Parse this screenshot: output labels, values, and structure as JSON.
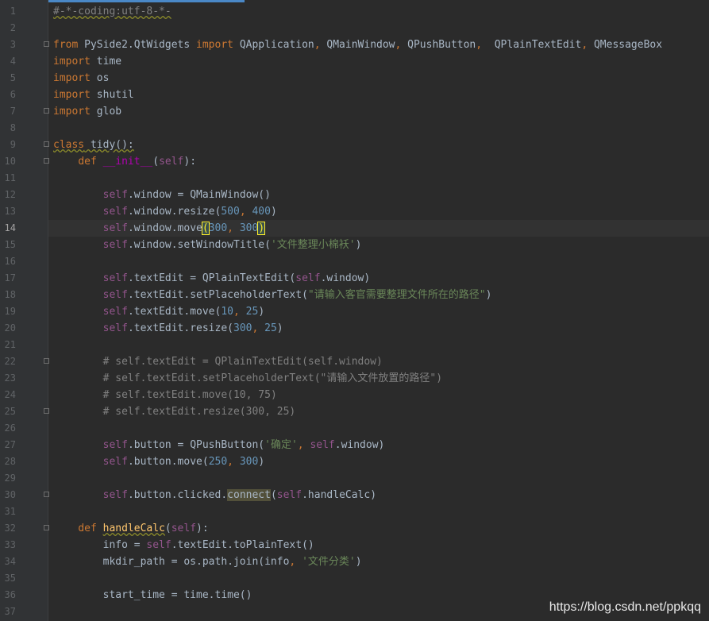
{
  "editor": {
    "watermark": "https://blog.csdn.net/ppkqq",
    "lines": [
      {
        "n": "1",
        "tokens": [
          [
            "#-*-coding:utf-8-*-",
            "cmt wavy"
          ]
        ]
      },
      {
        "n": "2",
        "tokens": []
      },
      {
        "n": "3",
        "fold": true,
        "tokens": [
          [
            "from",
            "kw"
          ],
          [
            " PySide2.QtWidgets ",
            ""
          ],
          [
            "import",
            "kw"
          ],
          [
            " QApplication",
            ""
          ],
          [
            ",",
            "kw"
          ],
          [
            " QMainWindow",
            ""
          ],
          [
            ",",
            "kw"
          ],
          [
            " QPushButton",
            ""
          ],
          [
            ",",
            "kw"
          ],
          [
            "  QPlainTextEdit",
            ""
          ],
          [
            ",",
            "kw"
          ],
          [
            " QMessageBox",
            ""
          ]
        ]
      },
      {
        "n": "4",
        "tokens": [
          [
            "import",
            "kw"
          ],
          [
            " time",
            ""
          ]
        ]
      },
      {
        "n": "5",
        "tokens": [
          [
            "import",
            "kw"
          ],
          [
            " os",
            ""
          ]
        ]
      },
      {
        "n": "6",
        "tokens": [
          [
            "import",
            "kw"
          ],
          [
            " shutil",
            ""
          ]
        ]
      },
      {
        "n": "7",
        "fold": true,
        "tokens": [
          [
            "import",
            "kw"
          ],
          [
            " glob",
            ""
          ]
        ]
      },
      {
        "n": "8",
        "tokens": []
      },
      {
        "n": "9",
        "fold": true,
        "tokens": [
          [
            "class",
            "kw wavy"
          ],
          [
            " tidy():",
            "wavy"
          ]
        ]
      },
      {
        "n": "10",
        "fold": true,
        "tokens": [
          [
            "    ",
            ""
          ],
          [
            "def",
            "kw"
          ],
          [
            " ",
            ""
          ],
          [
            "__init__",
            "magic"
          ],
          [
            "(",
            ""
          ],
          [
            "self",
            "self"
          ],
          [
            "):",
            ""
          ]
        ]
      },
      {
        "n": "11",
        "tokens": []
      },
      {
        "n": "12",
        "tokens": [
          [
            "        ",
            ""
          ],
          [
            "self",
            "self"
          ],
          [
            ".window = QMainWindow()",
            ""
          ]
        ]
      },
      {
        "n": "13",
        "tokens": [
          [
            "        ",
            ""
          ],
          [
            "self",
            "self"
          ],
          [
            ".window.resize(",
            ""
          ],
          [
            "500",
            "num"
          ],
          [
            ", ",
            "kw"
          ],
          [
            "400",
            "num"
          ],
          [
            ")",
            ""
          ]
        ]
      },
      {
        "n": "14",
        "current": true,
        "tokens": [
          [
            "        ",
            ""
          ],
          [
            "self",
            "self"
          ],
          [
            ".window.move",
            ""
          ],
          [
            "(",
            "brace-hl"
          ],
          [
            "300",
            "num"
          ],
          [
            ", ",
            "kw"
          ],
          [
            "300",
            "num"
          ],
          [
            ")",
            "brace-hl"
          ],
          [
            "|",
            "caret"
          ]
        ]
      },
      {
        "n": "15",
        "tokens": [
          [
            "        ",
            ""
          ],
          [
            "self",
            "self"
          ],
          [
            ".window.setWindowTitle(",
            ""
          ],
          [
            "'文件整理小棉袄'",
            "str"
          ],
          [
            ")",
            ""
          ]
        ]
      },
      {
        "n": "16",
        "tokens": []
      },
      {
        "n": "17",
        "tokens": [
          [
            "        ",
            ""
          ],
          [
            "self",
            "self"
          ],
          [
            ".textEdit = QPlainTextEdit(",
            ""
          ],
          [
            "self",
            "self"
          ],
          [
            ".window)",
            ""
          ]
        ]
      },
      {
        "n": "18",
        "tokens": [
          [
            "        ",
            ""
          ],
          [
            "self",
            "self"
          ],
          [
            ".textEdit.setPlaceholderText(",
            ""
          ],
          [
            "\"请输入客官需要整理文件所在的路径\"",
            "str"
          ],
          [
            ")",
            ""
          ]
        ]
      },
      {
        "n": "19",
        "tokens": [
          [
            "        ",
            ""
          ],
          [
            "self",
            "self"
          ],
          [
            ".textEdit.move(",
            ""
          ],
          [
            "10",
            "num"
          ],
          [
            ", ",
            "kw"
          ],
          [
            "25",
            "num"
          ],
          [
            ")",
            ""
          ]
        ]
      },
      {
        "n": "20",
        "tokens": [
          [
            "        ",
            ""
          ],
          [
            "self",
            "self"
          ],
          [
            ".textEdit.resize(",
            ""
          ],
          [
            "300",
            "num"
          ],
          [
            ", ",
            "kw"
          ],
          [
            "25",
            "num"
          ],
          [
            ")",
            ""
          ]
        ]
      },
      {
        "n": "21",
        "tokens": []
      },
      {
        "n": "22",
        "fold": true,
        "tokens": [
          [
            "        ",
            ""
          ],
          [
            "# self.textEdit = QPlainTextEdit(self.window)",
            "cmt"
          ]
        ]
      },
      {
        "n": "23",
        "tokens": [
          [
            "        ",
            ""
          ],
          [
            "# self.textEdit.setPlaceholderText(\"请输入文件放置的路径\")",
            "cmt"
          ]
        ]
      },
      {
        "n": "24",
        "tokens": [
          [
            "        ",
            ""
          ],
          [
            "# self.textEdit.move(10, 75)",
            "cmt"
          ]
        ]
      },
      {
        "n": "25",
        "fold": true,
        "tokens": [
          [
            "        ",
            ""
          ],
          [
            "# self.textEdit.resize(300, 25)",
            "cmt"
          ]
        ]
      },
      {
        "n": "26",
        "tokens": []
      },
      {
        "n": "27",
        "tokens": [
          [
            "        ",
            ""
          ],
          [
            "self",
            "self"
          ],
          [
            ".button = QPushButton(",
            ""
          ],
          [
            "'确定'",
            "str"
          ],
          [
            ", ",
            "kw"
          ],
          [
            "self",
            "self"
          ],
          [
            ".window)",
            ""
          ]
        ]
      },
      {
        "n": "28",
        "tokens": [
          [
            "        ",
            ""
          ],
          [
            "self",
            "self"
          ],
          [
            ".button.move(",
            ""
          ],
          [
            "250",
            "num"
          ],
          [
            ", ",
            "kw"
          ],
          [
            "300",
            "num"
          ],
          [
            ")",
            ""
          ]
        ]
      },
      {
        "n": "29",
        "tokens": []
      },
      {
        "n": "30",
        "fold": true,
        "tokens": [
          [
            "        ",
            ""
          ],
          [
            "self",
            "self"
          ],
          [
            ".button.clicked.",
            ""
          ],
          [
            "connect",
            "usage-hl"
          ],
          [
            "(",
            ""
          ],
          [
            "self",
            "self"
          ],
          [
            ".handleCalc)",
            ""
          ]
        ]
      },
      {
        "n": "31",
        "tokens": []
      },
      {
        "n": "32",
        "fold": true,
        "tokens": [
          [
            "    ",
            ""
          ],
          [
            "def",
            "kw"
          ],
          [
            " ",
            ""
          ],
          [
            "handleCalc",
            "fn wavy"
          ],
          [
            "(",
            ""
          ],
          [
            "self",
            "self"
          ],
          [
            "):",
            ""
          ]
        ]
      },
      {
        "n": "33",
        "tokens": [
          [
            "        info = ",
            ""
          ],
          [
            "self",
            "self"
          ],
          [
            ".textEdit.toPlainText()",
            ""
          ]
        ]
      },
      {
        "n": "34",
        "tokens": [
          [
            "        mkdir_path = os.path.join(info",
            ""
          ],
          [
            ", ",
            "kw"
          ],
          [
            "'文件分类'",
            "str"
          ],
          [
            ")",
            ""
          ]
        ]
      },
      {
        "n": "35",
        "tokens": []
      },
      {
        "n": "36",
        "tokens": [
          [
            "        start_time = time.time()",
            ""
          ]
        ]
      },
      {
        "n": "37",
        "tokens": []
      }
    ]
  }
}
